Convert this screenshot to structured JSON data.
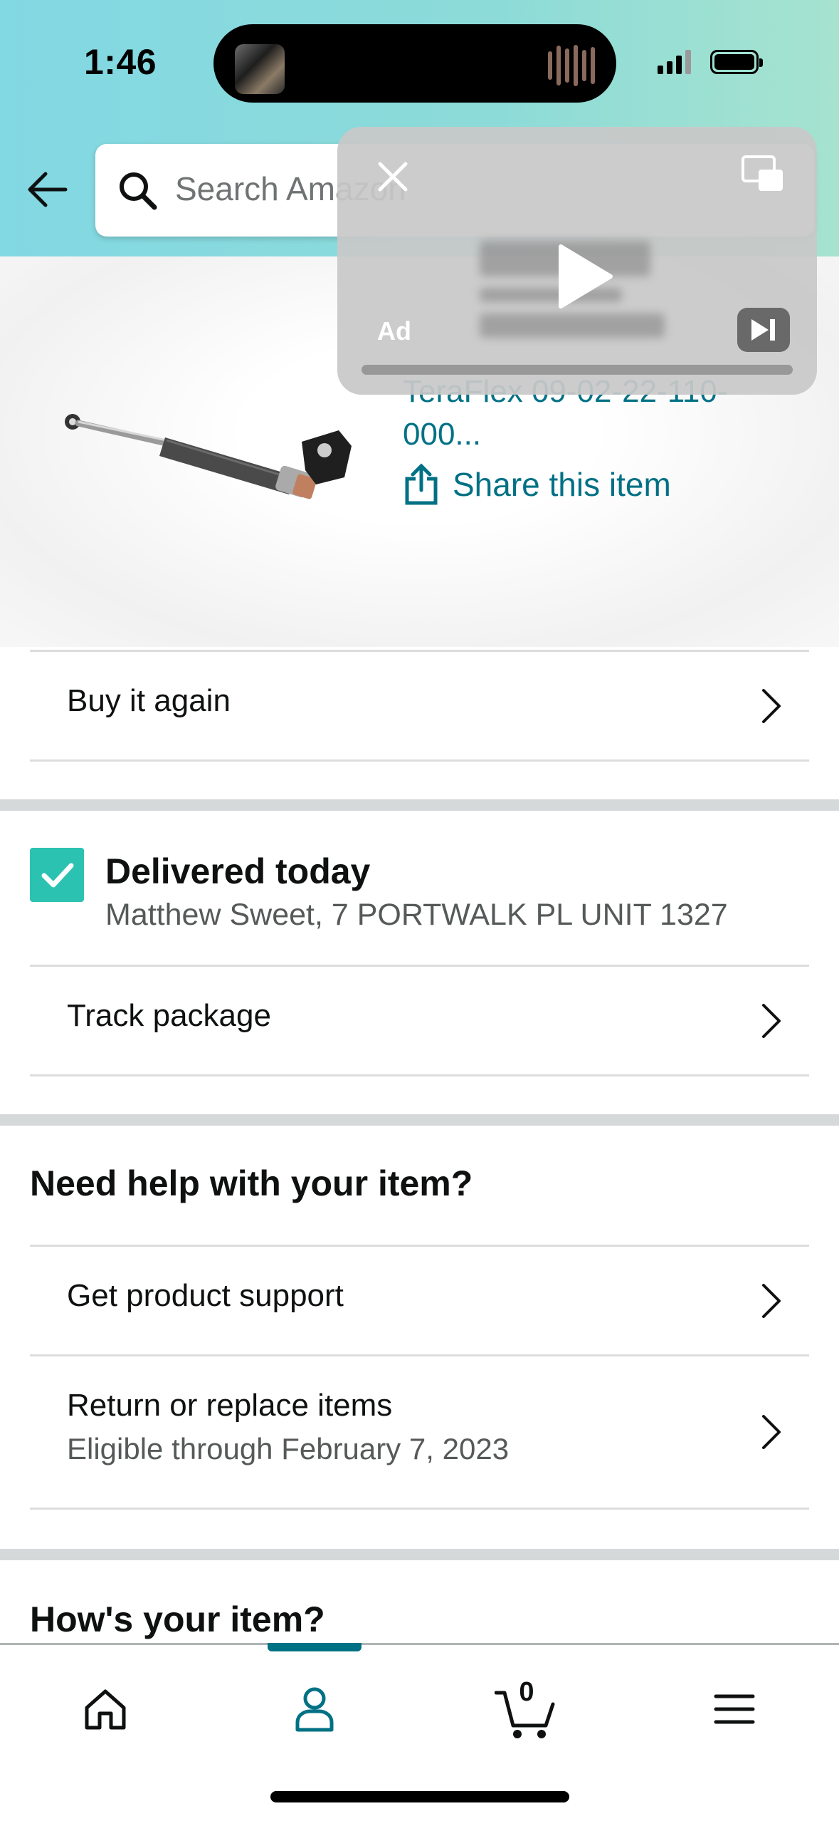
{
  "status_bar": {
    "time": "1:46"
  },
  "header": {
    "search_placeholder": "Search Amazon"
  },
  "product": {
    "title": "TeraFlex 09-02-22-110-000...",
    "share_label": "Share this item"
  },
  "ad": {
    "label": "Ad"
  },
  "actions": {
    "buy_again": "Buy it again"
  },
  "delivery": {
    "status": "Delivered today",
    "address": "Matthew Sweet, 7 PORTWALK PL UNIT 1327",
    "track_label": "Track package"
  },
  "help": {
    "title": "Need help with your item?",
    "product_support": "Get product support",
    "return_label": "Return or replace items",
    "return_eligibility": "Eligible through February 7, 2023"
  },
  "review": {
    "title": "How's your item?"
  },
  "bottom_nav": {
    "cart_count": "0",
    "active_tab": "account"
  },
  "colors": {
    "link": "#007185",
    "check": "#2bc2b2",
    "header_gradient_start": "#82d8e3",
    "header_gradient_end": "#a6e3cf"
  }
}
